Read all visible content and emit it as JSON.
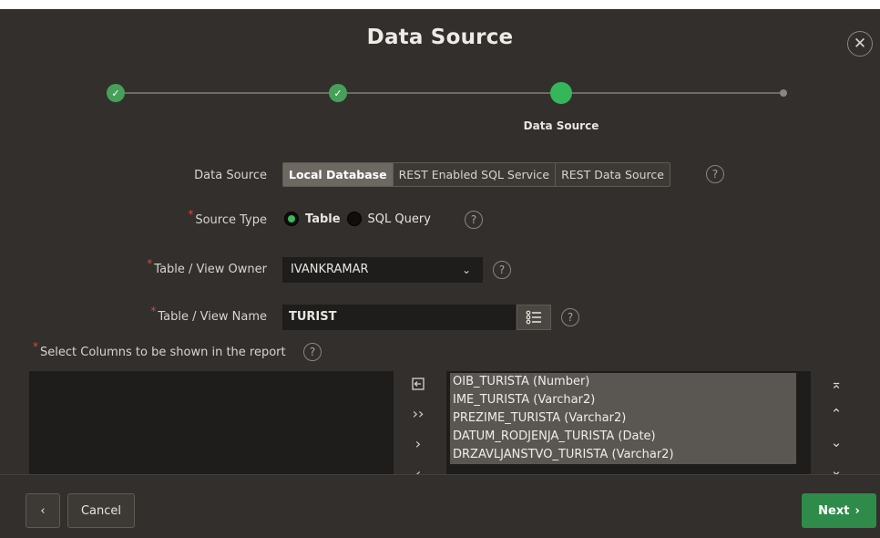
{
  "dialog": {
    "title": "Data Source",
    "close_icon": "close-icon"
  },
  "wizard": {
    "current_step_label": "Data Source",
    "steps": [
      {
        "state": "complete",
        "glyph": "✓"
      },
      {
        "state": "complete",
        "glyph": "✓"
      },
      {
        "state": "current"
      },
      {
        "state": "future"
      }
    ]
  },
  "form": {
    "data_source": {
      "label": "Data Source",
      "options": [
        "Local Database",
        "REST Enabled SQL Service",
        "REST Data Source"
      ],
      "selected": "Local Database"
    },
    "source_type": {
      "required_mark": "*",
      "label": "Source Type",
      "options": [
        "Table",
        "SQL Query"
      ],
      "selected": "Table"
    },
    "table_owner": {
      "required_mark": "*",
      "label": "Table / View Owner",
      "value": "IVANKRAMAR",
      "chevron": "⌄"
    },
    "table_name": {
      "required_mark": "*",
      "label": "Table / View Name",
      "value": "TURIST"
    },
    "columns": {
      "required_mark": "*",
      "label": "Select Columns to be shown in the report",
      "selected_items": [
        "OIB_TURISTA (Number)",
        "IME_TURISTA (Varchar2)",
        "PREZIME_TURISTA (Varchar2)",
        "DATUM_RODJENJA_TURISTA (Date)",
        "DRZAVLJANSTVO_TURISTA (Varchar2)"
      ],
      "controls": {
        "move_all": "››",
        "move": "›",
        "remove": "‹"
      },
      "order_controls": {
        "top": "⌅",
        "up": "⌃",
        "down": "⌄",
        "bottom": "⌄"
      }
    },
    "help_glyph": "?"
  },
  "footer": {
    "back_glyph": "‹",
    "cancel_label": "Cancel",
    "next_label": "Next",
    "next_glyph": "›"
  },
  "colors": {
    "background": "#322f2c",
    "accent_green": "#36b65a",
    "next_button": "#2e8b4a",
    "required": "#e0453b"
  }
}
